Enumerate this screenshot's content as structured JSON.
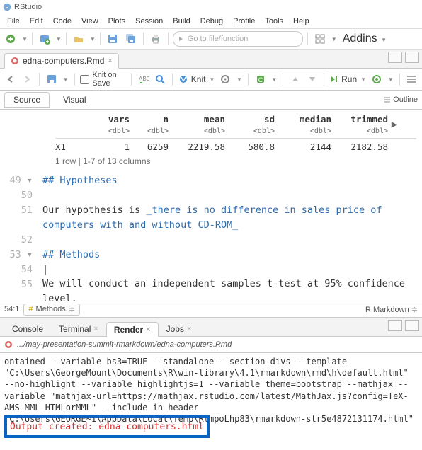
{
  "app": {
    "title": "RStudio"
  },
  "menu": [
    "File",
    "Edit",
    "Code",
    "View",
    "Plots",
    "Session",
    "Build",
    "Debug",
    "Profile",
    "Tools",
    "Help"
  ],
  "maintb": {
    "goto_placeholder": "Go to file/function",
    "addins": "Addins"
  },
  "file": {
    "tab": "edna-computers.Rmd"
  },
  "editor": {
    "knit_on_save": "Knit on Save",
    "knit": "Knit",
    "run": "Run",
    "source": "Source",
    "visual": "Visual",
    "outline": "Outline"
  },
  "table": {
    "headers": [
      "",
      "vars",
      "n",
      "mean",
      "sd",
      "median",
      "trimmed"
    ],
    "dbl": "<dbl>",
    "row": {
      "label": "X1",
      "vars": "1",
      "n": "6259",
      "mean": "2219.58",
      "sd": "580.8",
      "median": "2144",
      "trimmed": "2182.58"
    },
    "footer": "1 row | 1-7 of 13 columns"
  },
  "code": {
    "l49": "## Hypotheses",
    "l51a": "Our hypothesis is ",
    "l51b": "_there is no difference in sales price of computers with and without CD-ROM_",
    "l53": "## Methods",
    "l55": "We will conduct an independent samples t-test at 95% confidence level."
  },
  "gutter": [
    "49",
    "50",
    "51",
    "",
    "52",
    "53",
    "54",
    "55",
    ""
  ],
  "status": {
    "pos": "54:1",
    "section": "Methods",
    "lang": "R Markdown"
  },
  "btabs": {
    "console": "Console",
    "terminal": "Terminal",
    "render": "Render",
    "jobs": "Jobs"
  },
  "render": {
    "path": ".../may-presentation-summit-rmarkdown/edna-computers.Rmd",
    "body": "ontained --variable bs3=TRUE --standalone --section-divs --template \"C:\\Users\\GeorgeMount\\Documents\\R\\win-library\\4.1\\rmarkdown\\rmd\\h\\default.html\" --no-highlight --variable highlightjs=1 --variable theme=bootstrap --mathjax --variable \"mathjax-url=https://mathjax.rstudio.com/latest/MathJax.js?config=TeX-AMS-MML_HTMLorMML\" --include-in-header \"C:\\Users\\GEORGE~1\\AppData\\Local\\Temp\\RtmpoLhp83\\rmarkdown-str5e4872131174.html\"",
    "output": "Output created: edna-computers.html"
  }
}
